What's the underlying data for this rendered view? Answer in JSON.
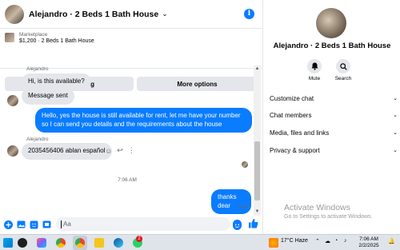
{
  "header": {
    "title": "Alejandro · 2 Beds 1 Bath House",
    "chevron_icon": "chevron-down-icon",
    "info_icon": "info-icon",
    "info_glyph": "i"
  },
  "marketplace": {
    "label": "Marketplace",
    "listing": "$1,200 · 2 Beds 1 Bath House",
    "mark_pending_label": "Mark as pending",
    "more_options_label": "More options"
  },
  "messages": [
    {
      "sender": "Alejandro",
      "text": "Hi, is this available?",
      "direction": "in"
    },
    {
      "text": "Message sent",
      "direction": "in"
    },
    {
      "text": "Hello, yes the house is still available for rent, let me have your number so I can send you details and the requirements about the house",
      "direction": "out"
    },
    {
      "sender": "Alejandro",
      "text": "2035456406 ablan español",
      "direction": "in"
    },
    {
      "text": "thanks dear",
      "direction": "out"
    }
  ],
  "timestamp": "7:06 AM",
  "sent_status": "Sent",
  "composer": {
    "placeholder": "Aa",
    "icons": [
      "plus-circle-icon",
      "image-icon",
      "sticker-icon",
      "gif-icon",
      "emoji-icon",
      "thumbs-up-icon"
    ]
  },
  "details": {
    "name": "Alejandro · 2 Beds 1 Bath House",
    "mute_label": "Mute",
    "search_label": "Search",
    "menu": [
      {
        "label": "Customize chat"
      },
      {
        "label": "Chat members"
      },
      {
        "label": "Media, files and links"
      },
      {
        "label": "Privacy & support"
      }
    ]
  },
  "watermark": {
    "title": "Activate Windows",
    "subtitle": "Go to Settings to activate Windows."
  },
  "taskbar": {
    "weather": "17°C  Haze",
    "time": "7:06 AM",
    "date": "2/2/2025",
    "badge": "2"
  },
  "colors": {
    "accent": "#0a7cff",
    "bubble_in": "#e4e6eb",
    "bubble_out": "#0a7cff",
    "watermark": "#9a9a9a"
  }
}
